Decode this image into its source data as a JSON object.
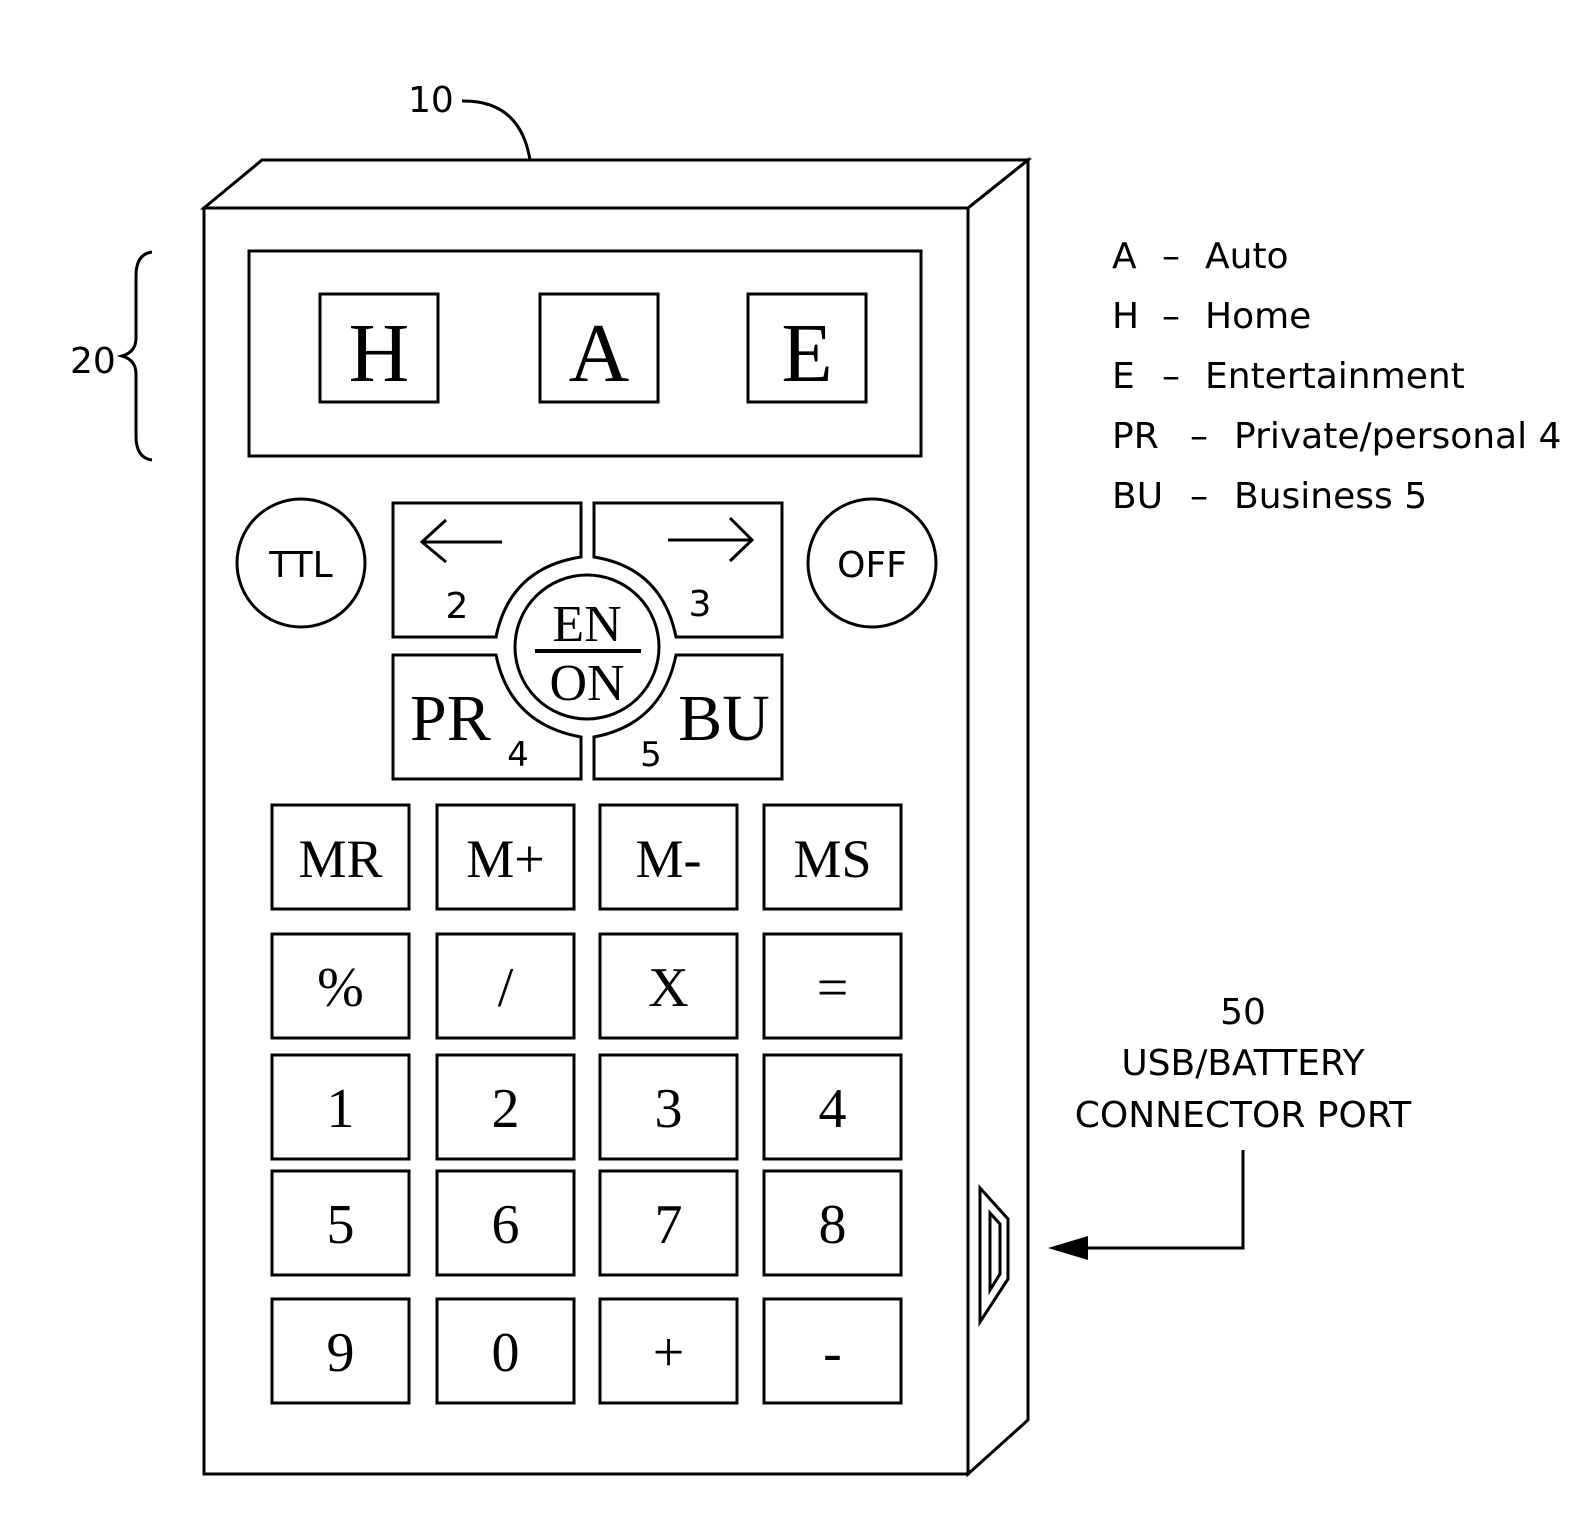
{
  "figure": {
    "ref_device": "10",
    "ref_display": "20",
    "ref_port": "50"
  },
  "display": {
    "letters": [
      "H",
      "A",
      "E"
    ]
  },
  "nav": {
    "ttl": "TTL",
    "off": "OFF",
    "left_num": "2",
    "right_num": "3",
    "center_top": "EN",
    "center_bottom": "ON",
    "pr_label": "PR",
    "pr_num": "4",
    "bu_label": "BU",
    "bu_num": "5"
  },
  "keys": [
    [
      "MR",
      "M+",
      "M-",
      "MS"
    ],
    [
      "%",
      "/",
      "X",
      "="
    ],
    [
      "1",
      "2",
      "3",
      "4"
    ],
    [
      "5",
      "6",
      "7",
      "8"
    ],
    [
      "9",
      "0",
      "+",
      "-"
    ]
  ],
  "legend": [
    {
      "key": "A",
      "dash": "–",
      "label": "Auto"
    },
    {
      "key": "H",
      "dash": "–",
      "label": "Home"
    },
    {
      "key": "E",
      "dash": "–",
      "label": "Entertainment"
    },
    {
      "key": "PR",
      "dash": "–",
      "label": "Private/personal 4"
    },
    {
      "key": "BU",
      "dash": "–",
      "label": "Business 5"
    }
  ],
  "port_label": {
    "line1": "USB/BATTERY",
    "line2": "CONNECTOR  PORT"
  }
}
